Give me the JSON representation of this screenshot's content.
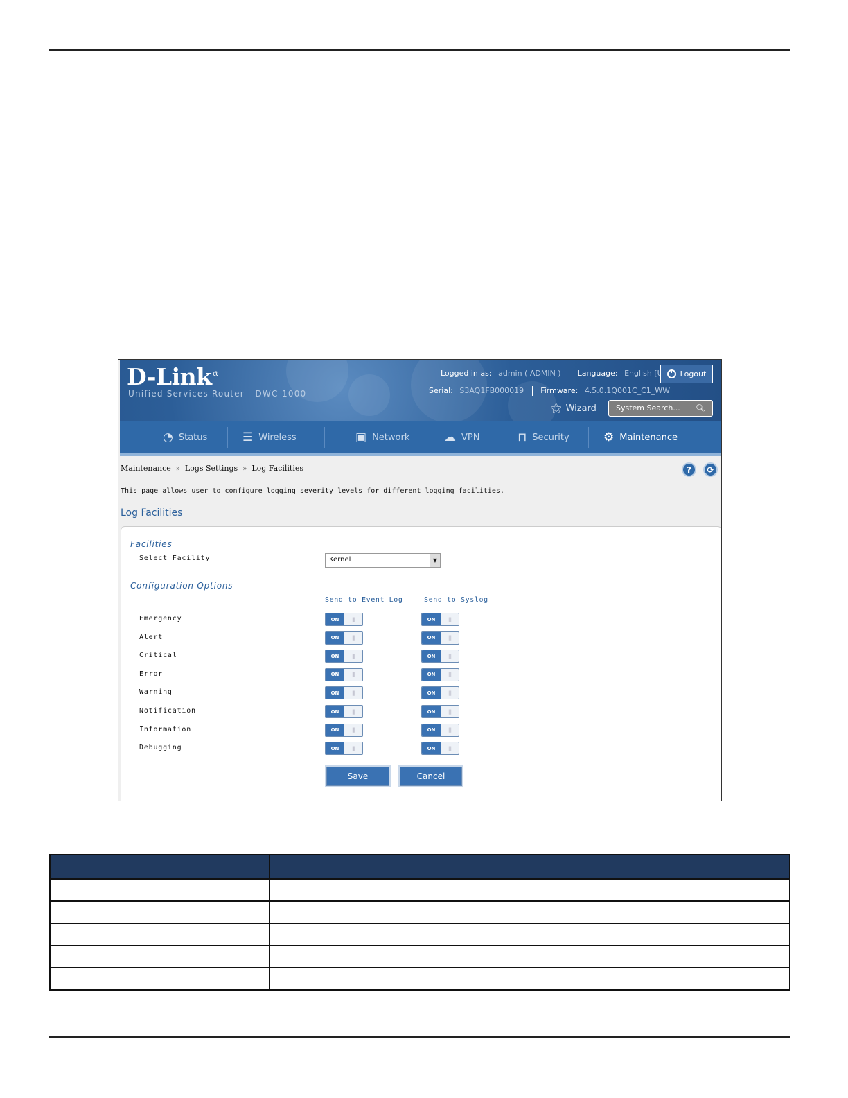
{
  "header": {
    "logo": "D-Link",
    "logo_mark": "®",
    "subtitle": "Unified Services Router - DWC-1000",
    "logged_in_label": "Logged in as:",
    "logged_in_value": "admin ( ADMIN )",
    "language_label": "Language:",
    "language_value": "English [US]",
    "logout_label": "Logout",
    "serial_label": "Serial:",
    "serial_value": "S3AQ1FB000019",
    "firmware_label": "Firmware:",
    "firmware_value": "4.5.0.1Q001C_C1_WW",
    "wizard_label": "Wizard",
    "search_placeholder": "System Search..."
  },
  "nav": {
    "items": [
      {
        "label": "Status",
        "icon": "gauge-icon"
      },
      {
        "label": "Wireless",
        "icon": "wifi-icon"
      },
      {
        "label": "Network",
        "icon": "computer-icon"
      },
      {
        "label": "VPN",
        "icon": "cloud-lock-icon"
      },
      {
        "label": "Security",
        "icon": "lock-icon"
      },
      {
        "label": "Maintenance",
        "icon": "gears-icon",
        "active": true
      }
    ]
  },
  "breadcrumb": [
    "Maintenance",
    "Logs Settings",
    "Log Facilities"
  ],
  "breadcrumb_sep": "»",
  "help_icon": "?",
  "description": "This page allows user to configure logging severity levels for different logging facilities.",
  "section_title": "Log Facilities",
  "facilities": {
    "heading": "Facilities",
    "select_label": "Select Facility",
    "select_value": "Kernel"
  },
  "config": {
    "heading": "Configuration Options",
    "col_event_log": "Send to Event Log",
    "col_syslog": "Send to Syslog",
    "toggle_on_text": "ON",
    "levels": [
      {
        "name": "Emergency",
        "event_log": true,
        "syslog": true
      },
      {
        "name": "Alert",
        "event_log": true,
        "syslog": true
      },
      {
        "name": "Critical",
        "event_log": true,
        "syslog": true
      },
      {
        "name": "Error",
        "event_log": true,
        "syslog": true
      },
      {
        "name": "Warning",
        "event_log": true,
        "syslog": true
      },
      {
        "name": "Notification",
        "event_log": true,
        "syslog": true
      },
      {
        "name": "Information",
        "event_log": true,
        "syslog": true
      },
      {
        "name": "Debugging",
        "event_log": true,
        "syslog": true
      }
    ]
  },
  "buttons": {
    "save": "Save",
    "cancel": "Cancel"
  },
  "colors": {
    "brand_blue": "#2f69a8",
    "table_header": "#213a5f",
    "accent_text": "#2a5f9b"
  }
}
